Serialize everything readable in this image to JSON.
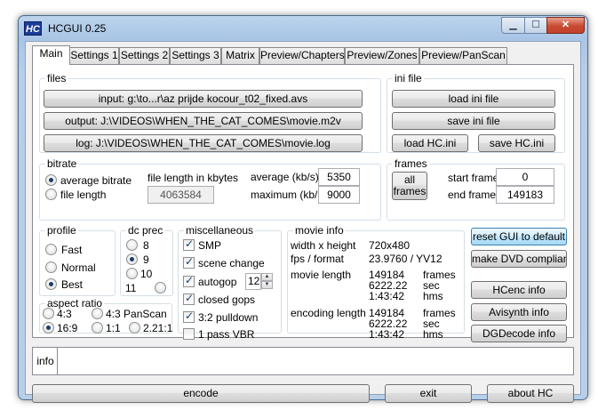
{
  "window": {
    "title": "HCGUI 0.25",
    "icon_text": "HC"
  },
  "tabs": [
    "Main",
    "Settings 1",
    "Settings 2",
    "Settings 3",
    "Matrix",
    "Preview/Chapters",
    "Preview/Zones",
    "Preview/PanScan"
  ],
  "files": {
    "title": "files",
    "input_btn": "input: g:\\to...r\\az prijde kocour_t02_fixed.avs",
    "output_btn": "output: J:\\VIDEOS\\WHEN_THE_CAT_COMES\\movie.m2v",
    "log_btn": "log: J:\\VIDEOS\\WHEN_THE_CAT_COMES\\movie.log"
  },
  "ini": {
    "title": "ini file",
    "load": "load ini file",
    "save": "save ini file",
    "load_hc": "load HC.ini",
    "save_hc": "save HC.ini"
  },
  "bitrate": {
    "title": "bitrate",
    "avg_label": "average bitrate",
    "file_label": "file length",
    "file_length_label": "file length in kbytes",
    "file_length_value": "4063584",
    "average_label": "average (kb/s)",
    "average_value": "5350",
    "maximum_label": "maximum (kb/s)",
    "maximum_value": "9000"
  },
  "frames": {
    "title": "frames",
    "all_line1": "all",
    "all_line2": "frames",
    "start_label": "start frame",
    "start_value": "0",
    "end_label": "end frame",
    "end_value": "149183"
  },
  "profile": {
    "title": "profile",
    "options": [
      "Fast",
      "Normal",
      "Best"
    ]
  },
  "dcprec": {
    "title": "dc prec",
    "options": [
      "8",
      "9",
      "10",
      "11"
    ]
  },
  "aspect": {
    "title": "aspect ratio",
    "opt1": "4:3",
    "opt2": "4:3 PanScan",
    "opt3": "16:9",
    "opt4": "1:1",
    "opt5": "2.21:1"
  },
  "misc": {
    "title": "miscellaneous",
    "smp": "SMP",
    "scene_change": "scene change",
    "autogop": "autogop",
    "autogop_value": "12",
    "closed_gops": "closed gops",
    "pulldown": "3:2 pulldown",
    "pass_vbr": "1 pass VBR"
  },
  "movie": {
    "title": "movie info",
    "wh_label": "width x height",
    "wh_value": "720x480",
    "fps_label": "fps / format",
    "fps_value": "23.9760 / YV12",
    "len_label": "movie length",
    "len_frames": "149184",
    "len_sec": "6222.22",
    "len_hms": "1:43:42",
    "enc_label": "encoding length",
    "enc_frames": "149184",
    "enc_sec": "6222.22",
    "enc_hms": "1:43:42",
    "unit_frames": "frames",
    "unit_sec": "sec",
    "unit_hms": "hms"
  },
  "side_buttons": {
    "reset": "reset GUI to default",
    "dvd": "make DVD compliant",
    "hcenc": "HCenc info",
    "avisynth": "Avisynth info",
    "dgdecode": "DGDecode info"
  },
  "info_tab": "info",
  "bottom": {
    "encode": "encode",
    "exit": "exit",
    "about": "about HC"
  }
}
